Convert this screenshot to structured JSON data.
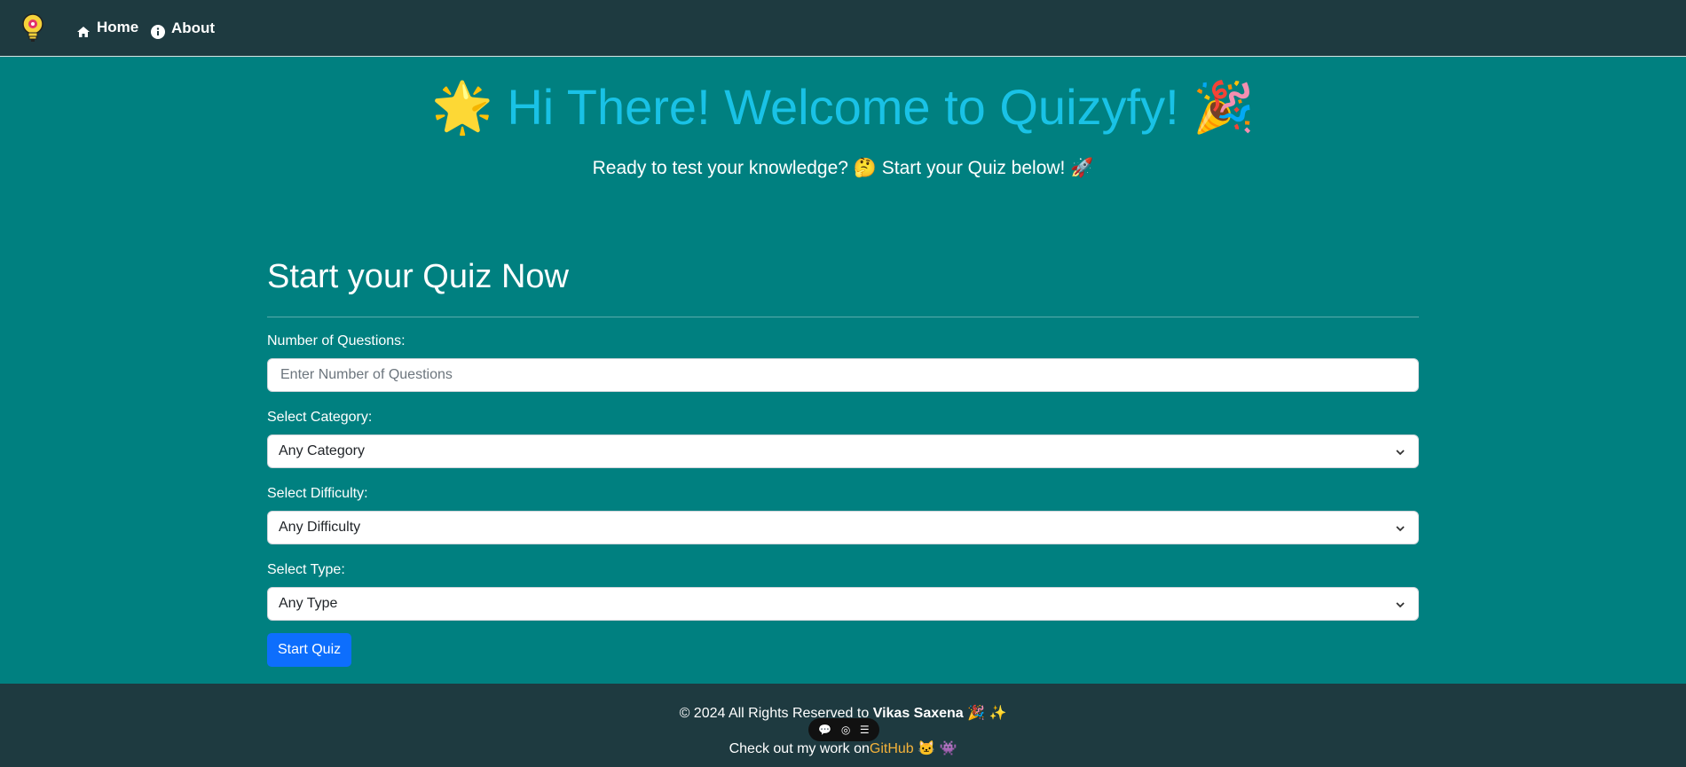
{
  "nav": {
    "home_label": "Home",
    "about_label": "About"
  },
  "hero": {
    "title": "🌟 Hi There! Welcome to Quizyfy! 🎉",
    "subtitle": "Ready to test your knowledge? 🤔 Start your Quiz below! 🚀"
  },
  "form": {
    "title": "Start your Quiz Now",
    "num_questions_label": "Number of Questions:",
    "num_questions_placeholder": "Enter Number of Questions",
    "category_label": "Select Category:",
    "category_value": "Any Category",
    "difficulty_label": "Select Difficulty:",
    "difficulty_value": "Any Difficulty",
    "type_label": "Select Type:",
    "type_value": "Any Type",
    "start_button": "Start Quiz"
  },
  "footer": {
    "copyright_prefix": "© 2024 All Rights Reserved to ",
    "author": "Vikas Saxena",
    "copyright_suffix": " 🎉 ✨",
    "work_prefix": "Check out my work on",
    "github_label": "GitHub",
    "work_suffix": " 🐱 👾"
  },
  "toolbar": {
    "comment_icon": "💬",
    "view_icon": "◎",
    "menu_icon": "☰"
  },
  "colors": {
    "page_bg": "#008080",
    "nav_bg": "#1e3a40",
    "title": "#19c2e6",
    "button": "#0d6efd",
    "github_link": "#f4b23a"
  }
}
